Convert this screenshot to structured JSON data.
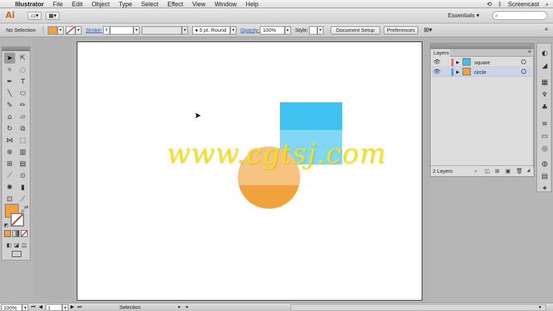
{
  "menubar": {
    "app_name": "Illustrator",
    "items": [
      "File",
      "Edit",
      "Object",
      "Type",
      "Select",
      "Effect",
      "View",
      "Window",
      "Help"
    ],
    "right_status": "Screencast"
  },
  "appbar": {
    "logo": "Ai",
    "workspace": "Essentials"
  },
  "controlbar": {
    "selection_label": "No Selection",
    "fill_color": "#f2a23c",
    "stroke_label": "Stroke:",
    "brush_value": "5 pt. Round",
    "opacity_label": "Opacity:",
    "opacity_value": "100%",
    "style_label": "Style:",
    "document_setup": "Document Setup",
    "preferences": "Preferences"
  },
  "canvas": {
    "square_color": "#3fc3ee",
    "circle_color": "#f2a23c",
    "watermark": "www.cgtsj.com"
  },
  "tools": {
    "fill_color": "#f2a23c"
  },
  "layers": {
    "tab_label": "Layers",
    "rows": [
      {
        "name": "square",
        "color": "#3fc3ee",
        "label_color": "#e07070"
      },
      {
        "name": "circle",
        "color": "#f2a23c",
        "label_color": "#6a8ee0"
      }
    ],
    "count_label": "2 Layers"
  },
  "statusbar": {
    "zoom": "100%",
    "artboard": "1",
    "mode": "Selection"
  }
}
